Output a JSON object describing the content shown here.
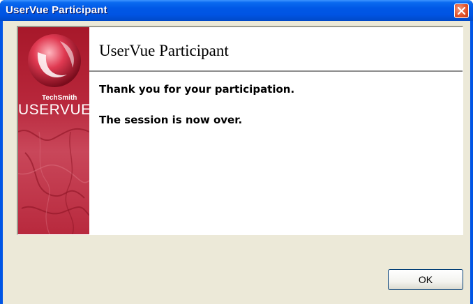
{
  "window": {
    "title": "UserVue Participant",
    "close_icon": "close-icon"
  },
  "brand": {
    "company": "TechSmith",
    "product": "USERVUE"
  },
  "dialog": {
    "heading": "UserVue Participant",
    "message_line1": "Thank you for your participation.",
    "message_line2": "The session is now over."
  },
  "buttons": {
    "ok_label": "OK"
  },
  "colors": {
    "titlebar": "#0054e3",
    "body": "#ece9d8",
    "brand": "#b7263a",
    "close": "#e2542d"
  }
}
